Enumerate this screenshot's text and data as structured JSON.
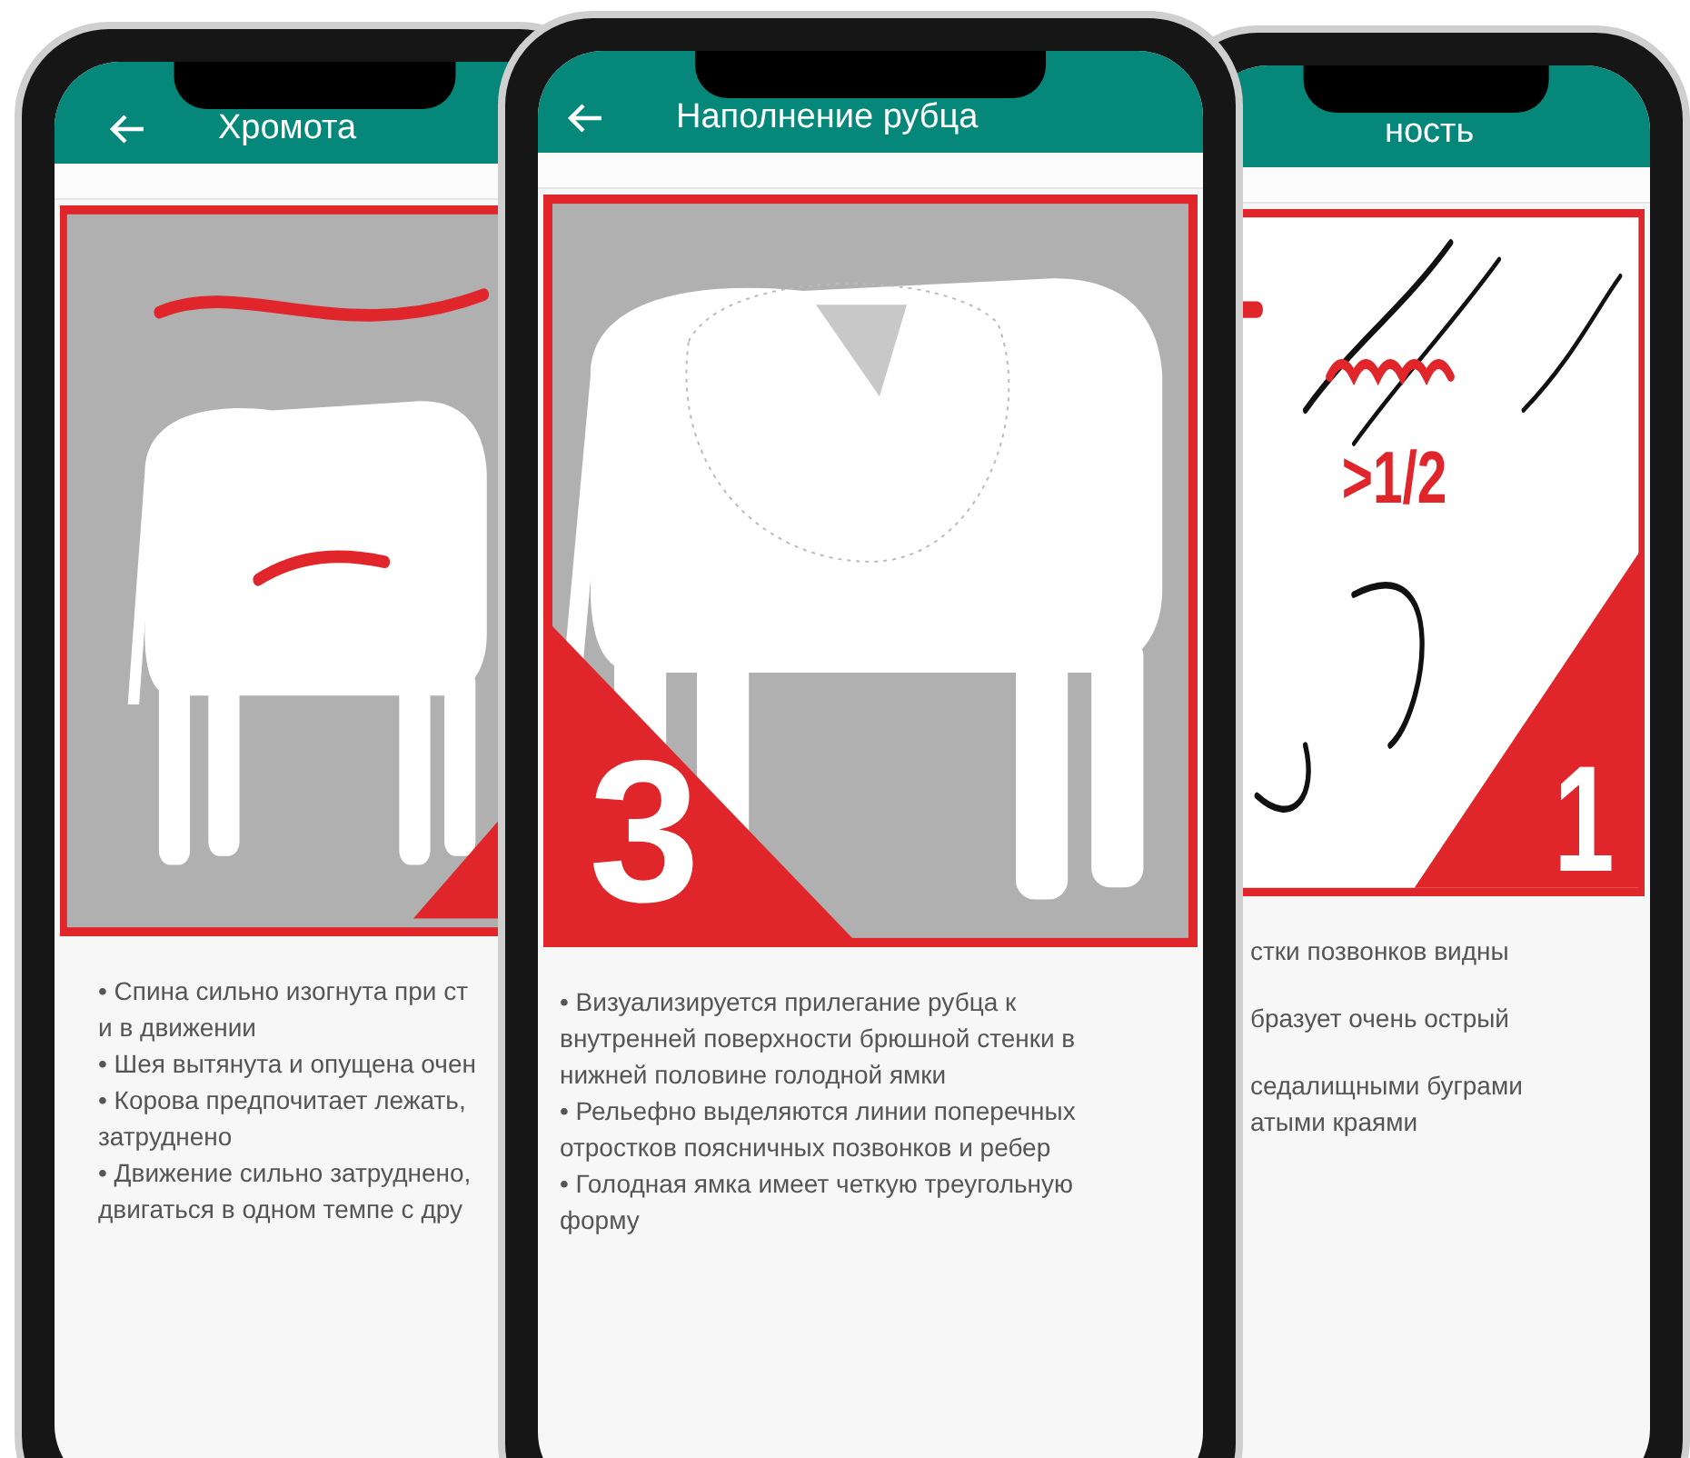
{
  "phones": [
    {
      "title": "Хромота",
      "illustration": {
        "kind": "arched-back"
      },
      "paragraphs": [
        {
          "lines": [
            "• Спина сильно изогнута при ст",
            "и в движении"
          ]
        },
        {
          "lines": [
            "• Шея вытянута и опущена очен"
          ]
        },
        {
          "lines": [
            "• Корова предпочитает лежать,",
            "затруднено"
          ]
        },
        {
          "lines": [
            "• Движение сильно затруднено,",
            "двигаться в одном темпе с дру"
          ]
        }
      ]
    },
    {
      "title": "Наполнение рубца",
      "illustration": {
        "kind": "rumen",
        "number": "3"
      },
      "paragraphs": [
        {
          "lines": [
            "• Визуализируется прилегание рубца к",
            "внутренней поверхности брюшной стенки в",
            "нижней половине голодной ямки"
          ]
        },
        {
          "lines": [
            "• Рельефно выделяются линии поперечных",
            "отростков поясничных позвонков и ребер"
          ]
        },
        {
          "lines": [
            "• Голодная ямка имеет четкую треугольную",
            "форму"
          ]
        }
      ]
    },
    {
      "title": "ность",
      "illustration": {
        "kind": "closeup",
        "number": "1",
        "label": ">1/2"
      },
      "paragraphs": [
        {
          "lines": [
            "стки позвонков видны"
          ]
        },
        {
          "lines": [
            "бразует очень острый"
          ]
        },
        {
          "lines": [
            "седалищными буграми",
            "атыми краями"
          ]
        }
      ]
    }
  ]
}
